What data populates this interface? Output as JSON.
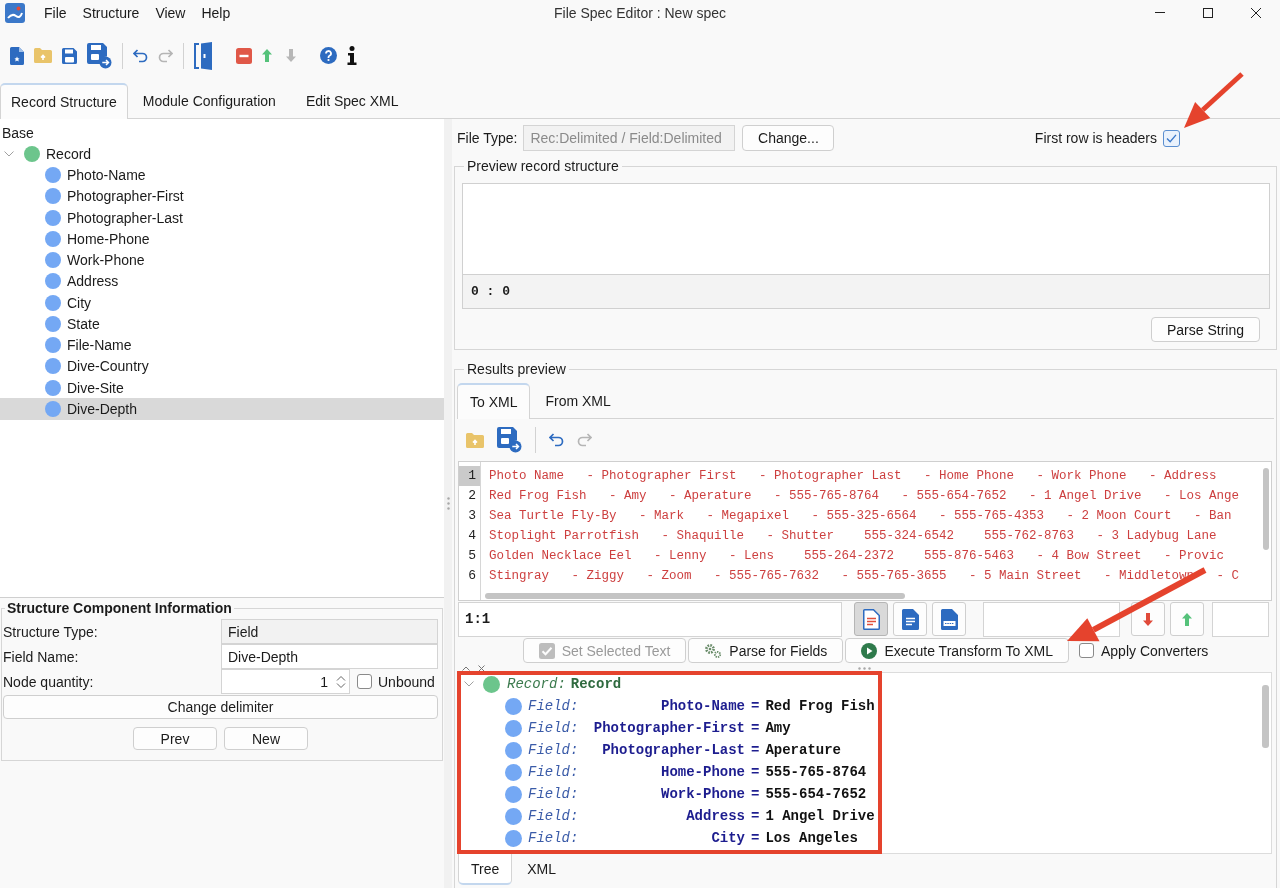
{
  "window": {
    "title": "File Spec Editor : New spec"
  },
  "menu": [
    "File",
    "Structure",
    "View",
    "Help"
  ],
  "toolbar": [
    {
      "kind": "new",
      "disabled": false
    },
    {
      "kind": "open",
      "disabled": false
    },
    {
      "kind": "save",
      "disabled": false
    },
    {
      "kind": "saveas",
      "disabled": false
    },
    {
      "kind": "separator"
    },
    {
      "kind": "undo",
      "disabled": false
    },
    {
      "kind": "redo",
      "disabled": true
    },
    {
      "kind": "separator"
    },
    {
      "kind": "door",
      "disabled": false
    },
    {
      "kind": "remove",
      "disabled": false
    },
    {
      "kind": "up",
      "disabled": false
    },
    {
      "kind": "down",
      "disabled": true
    },
    {
      "kind": "help",
      "disabled": false
    },
    {
      "kind": "info",
      "disabled": false
    }
  ],
  "main_tabs": [
    {
      "label": "Record Structure",
      "selected": true
    },
    {
      "label": "Module Configuration",
      "selected": false
    },
    {
      "label": "Edit Spec XML",
      "selected": false
    }
  ],
  "structure_tree": {
    "label": "Base",
    "nodes": [
      {
        "label": "Record",
        "kind": "record",
        "expanded": true,
        "selected": false,
        "children": [
          {
            "label": "Photo-Name",
            "kind": "field",
            "selected": false
          },
          {
            "label": "Photographer-First",
            "kind": "field",
            "selected": false
          },
          {
            "label": "Photographer-Last",
            "kind": "field",
            "selected": false
          },
          {
            "label": "Home-Phone",
            "kind": "field",
            "selected": false
          },
          {
            "label": "Work-Phone",
            "kind": "field",
            "selected": false
          },
          {
            "label": "Address",
            "kind": "field",
            "selected": false
          },
          {
            "label": "City",
            "kind": "field",
            "selected": false
          },
          {
            "label": "State",
            "kind": "field",
            "selected": false
          },
          {
            "label": "File-Name",
            "kind": "field",
            "selected": false
          },
          {
            "label": "Dive-Country",
            "kind": "field",
            "selected": false
          },
          {
            "label": "Dive-Site",
            "kind": "field",
            "selected": false
          },
          {
            "label": "Dive-Depth",
            "kind": "field",
            "selected": true
          }
        ]
      }
    ]
  },
  "component_info": {
    "title": "Structure Component Information",
    "fields": [
      {
        "label": "Structure Type:",
        "value": "Field",
        "kind": "readonly"
      },
      {
        "label": "Field Name:",
        "value": "Dive-Depth",
        "kind": "text"
      },
      {
        "label": "Node quantity:",
        "value": "1",
        "kind": "spinner"
      }
    ],
    "unbound": {
      "label": "Unbound",
      "checked": false
    },
    "change_button": "Change delimiter",
    "nav_buttons": [
      "Prev",
      "New"
    ]
  },
  "file_type": {
    "label": "File Type:",
    "value": "Rec:Delimited / Field:Delimited",
    "disabled": true,
    "button": "Change...",
    "first_row_headers": {
      "label": "First row is headers",
      "checked": true
    }
  },
  "preview": {
    "title": "Preview record structure",
    "position": "0 : 0",
    "button": "Parse String"
  },
  "results": {
    "title": "Results preview",
    "tabs": [
      {
        "label": "To XML",
        "selected": true
      },
      {
        "label": "From XML",
        "selected": false
      }
    ],
    "toolbar": [
      {
        "kind": "open",
        "disabled": false
      },
      {
        "kind": "saveas",
        "disabled": false
      },
      {
        "kind": "separator"
      },
      {
        "kind": "undo",
        "disabled": false
      },
      {
        "kind": "redo",
        "disabled": true
      }
    ],
    "editor": {
      "lines": [
        {
          "number": "1",
          "current": true,
          "text": "Photo Name   - Photographer First   - Photographer Last   - Home Phone   - Work Phone   - Address"
        },
        {
          "number": "2",
          "current": false,
          "text": "Red Frog Fish   - Amy   - Aperature   - 555-765-8764   - 555-654-7652   - 1 Angel Drive   - Los Ange"
        },
        {
          "number": "3",
          "current": false,
          "text": "Sea Turtle Fly-By   - Mark   - Megapixel   - 555-325-6564   - 555-765-4353   - 2 Moon Court   - Ban"
        },
        {
          "number": "4",
          "current": false,
          "text": "Stoplight Parrotfish   - Shaquille   - Shutter    555-324-6542    555-762-8763   - 3 Ladybug Lane"
        },
        {
          "number": "5",
          "current": false,
          "text": "Golden Necklace Eel   - Lenny   - Lens    555-264-2372    555-876-5463   - 4 Bow Street   - Provic"
        },
        {
          "number": "6",
          "current": false,
          "text": "Stingray   - Ziggy   - Zoom   - 555-765-7632   - 555-765-3655   - 5 Main Street   - Middletown   - C"
        }
      ]
    },
    "cursor": "1:1",
    "view_buttons": [
      {
        "kind": "text",
        "selected": true
      },
      {
        "kind": "document",
        "selected": false
      },
      {
        "kind": "html",
        "selected": false
      }
    ],
    "nav_buttons": [
      {
        "kind": "down"
      },
      {
        "kind": "up"
      }
    ],
    "actions": [
      {
        "label": "Set Selected Text",
        "kind": "check",
        "disabled": true
      },
      {
        "label": "Parse for Fields",
        "kind": "gears",
        "disabled": false
      },
      {
        "label": "Execute Transform To XML",
        "kind": "play",
        "disabled": false
      }
    ],
    "apply_converters": {
      "label": "Apply Converters",
      "checked": false
    },
    "tree": {
      "type_label": "Record:",
      "name": "Record",
      "kind": "record",
      "expanded": true,
      "children": [
        {
          "kind": "field",
          "type_label": "Field:",
          "name": "Photo-Name",
          "operator": "=",
          "value": "Red Frog Fish"
        },
        {
          "kind": "field",
          "type_label": "Field:",
          "name": "Photographer-First",
          "operator": "=",
          "value": "Amy"
        },
        {
          "kind": "field",
          "type_label": "Field:",
          "name": "Photographer-Last",
          "operator": "=",
          "value": "Aperature"
        },
        {
          "kind": "field",
          "type_label": "Field:",
          "name": "Home-Phone",
          "operator": "=",
          "value": "555-765-8764"
        },
        {
          "kind": "field",
          "type_label": "Field:",
          "name": "Work-Phone",
          "operator": "=",
          "value": "555-654-7652"
        },
        {
          "kind": "field",
          "type_label": "Field:",
          "name": "Address",
          "operator": "=",
          "value": "1 Angel Drive"
        },
        {
          "kind": "field",
          "type_label": "Field:",
          "name": "City",
          "operator": "=",
          "value": "Los Angeles"
        }
      ]
    },
    "bottom_tabs": [
      {
        "label": "Tree",
        "selected": true
      },
      {
        "label": "XML",
        "selected": false
      }
    ]
  },
  "annotations": [
    {
      "kind": "arrow"
    },
    {
      "kind": "arrow"
    },
    {
      "kind": "frame"
    }
  ]
}
